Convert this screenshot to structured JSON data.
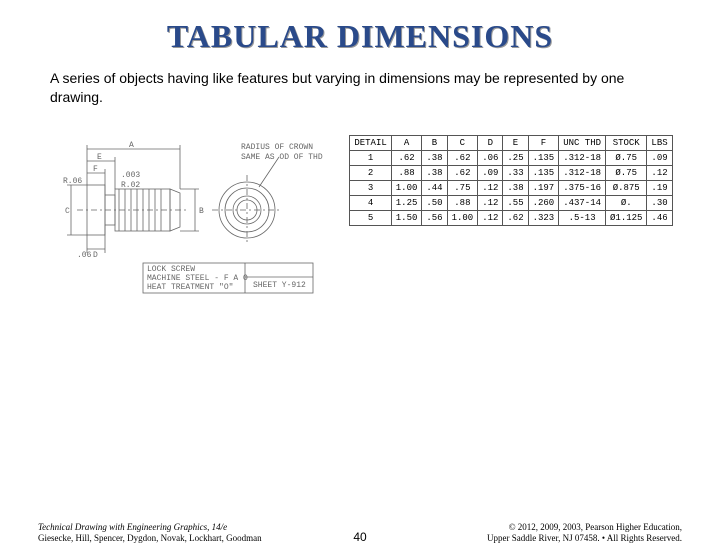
{
  "title": "TABULAR DIMENSIONS",
  "description": "A series of objects having like features but varying in dimensions may be represented by one drawing.",
  "drawing_labels": {
    "A": "A",
    "B": "B",
    "C": "C",
    "D": "D",
    "E": "E",
    "F": "F",
    "r06": "R.06",
    "r02": "R.02",
    "val003": ".003",
    "plusminus": "±",
    "note1a": "RADIUS OF CROWN",
    "note1b": "SAME AS OD OF THD",
    "note2a": "LOCK SCREW",
    "note2b": "MACHINE STEEL - F A O",
    "note2c": "HEAT TREATMENT \"O\"",
    "sheet": "SHEET Y-912",
    "tick": ".06"
  },
  "table": {
    "headers": [
      "DETAIL",
      "A",
      "B",
      "C",
      "D",
      "E",
      "F",
      "UNC THD",
      "STOCK",
      "LBS"
    ],
    "rows": [
      [
        "1",
        ".62",
        ".38",
        ".62",
        ".06",
        ".25",
        ".135",
        ".312-18",
        "Ø.75",
        ".09"
      ],
      [
        "2",
        ".88",
        ".38",
        ".62",
        ".09",
        ".33",
        ".135",
        ".312-18",
        "Ø.75",
        ".12"
      ],
      [
        "3",
        "1.00",
        ".44",
        ".75",
        ".12",
        ".38",
        ".197",
        ".375-16",
        "Ø.875",
        ".19"
      ],
      [
        "4",
        "1.25",
        ".50",
        ".88",
        ".12",
        ".55",
        ".260",
        ".437-14",
        "Ø.",
        ".30"
      ],
      [
        "5",
        "1.50",
        ".56",
        "1.00",
        ".12",
        ".62",
        ".323",
        ".5-13",
        "Ø1.125",
        ".46"
      ]
    ]
  },
  "footer": {
    "book": "Technical Drawing with Engineering Graphics, 14/e",
    "authors": "Giesecke, Hill, Spencer, Dygdon, Novak, Lockhart, Goodman",
    "page": "40",
    "copyright": "© 2012, 2009, 2003, Pearson Higher Education,",
    "address": "Upper Saddle River, NJ 07458. • All Rights Reserved."
  }
}
